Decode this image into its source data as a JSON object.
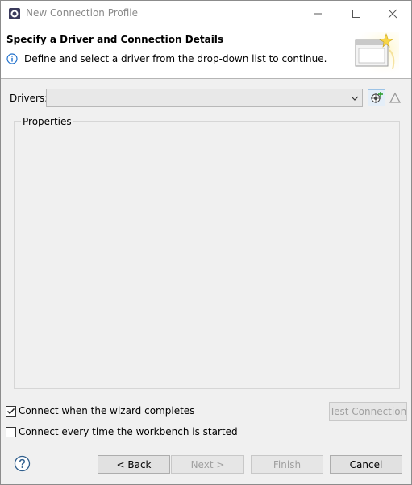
{
  "window": {
    "title": "New Connection Profile"
  },
  "banner": {
    "title": "Specify a Driver and Connection Details",
    "message": "Define and select a driver from the drop-down list to continue.",
    "message_icon": "info-icon",
    "image": "wizard-banner-image"
  },
  "drivers": {
    "label": "Drivers:",
    "selected": ""
  },
  "properties": {
    "label": "Properties"
  },
  "options": {
    "connect_on_complete_label": "Connect when the wizard completes",
    "connect_on_complete_checked": true,
    "connect_on_startup_label": "Connect every time the workbench is started",
    "connect_on_startup_checked": false
  },
  "buttons": {
    "test_connection": "Test Connection",
    "back": "< Back",
    "next": "Next >",
    "finish": "Finish",
    "cancel": "Cancel"
  },
  "colors": {
    "dialog_bg": "#f0f0f0",
    "banner_bg": "#ffffff",
    "info_blue": "#1e6fcc",
    "disabled_text": "#a0a0a0"
  }
}
